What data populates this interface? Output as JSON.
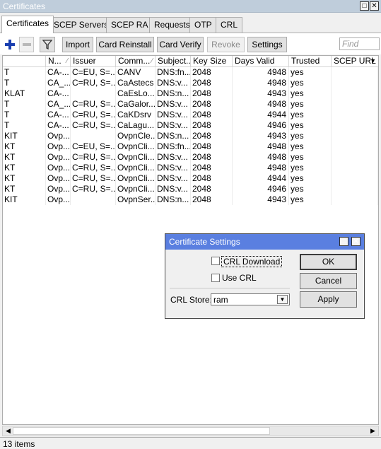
{
  "window": {
    "title": "Certificates"
  },
  "tabs": [
    "Certificates",
    "SCEP Servers",
    "SCEP RA",
    "Requests",
    "OTP",
    "CRL"
  ],
  "toolbar": {
    "add_icon": "plus-icon",
    "remove_icon": "minus-icon",
    "filter_icon": "filter-icon",
    "import": "Import",
    "card_reinstall": "Card Reinstall",
    "card_verify": "Card Verify",
    "revoke": "Revoke",
    "settings": "Settings",
    "find_placeholder": "Find"
  },
  "table": {
    "headers": [
      "",
      "N...",
      "Issuer",
      "Comm...",
      "Subject...",
      "Key Size",
      "Days Valid",
      "Trusted",
      "SCEP URL"
    ],
    "rows": [
      [
        "T",
        "CA-...",
        "C=EU, S=...",
        "CANV",
        "DNS:fn...",
        "2048",
        "4948",
        "yes",
        ""
      ],
      [
        "T",
        "CA_...",
        "C=RU, S=...",
        "CaAstecs",
        "DNS:v...",
        "2048",
        "4948",
        "yes",
        ""
      ],
      [
        "KLAT",
        "CA-...",
        "",
        "CaEsLo...",
        "DNS:n...",
        "2048",
        "4943",
        "yes",
        ""
      ],
      [
        "T",
        "CA_...",
        "C=RU, S=...",
        "CaGalor...",
        "DNS:v...",
        "2048",
        "4948",
        "yes",
        ""
      ],
      [
        "T",
        "CA-...",
        "C=RU, S=...",
        "CaKDsrv",
        "DNS:v...",
        "2048",
        "4944",
        "yes",
        ""
      ],
      [
        "T",
        "CA-...",
        "C=RU, S=...",
        "CaLagu...",
        "DNS:v...",
        "2048",
        "4946",
        "yes",
        ""
      ],
      [
        "KIT",
        "Ovp...",
        "",
        "OvpnCle...",
        "DNS:n...",
        "2048",
        "4943",
        "yes",
        ""
      ],
      [
        "KT",
        "Ovp...",
        "C=EU, S=...",
        "OvpnCli...",
        "DNS:fn...",
        "2048",
        "4948",
        "yes",
        ""
      ],
      [
        "KT",
        "Ovp...",
        "C=RU, S=...",
        "OvpnCli...",
        "DNS:v...",
        "2048",
        "4948",
        "yes",
        ""
      ],
      [
        "KT",
        "Ovp...",
        "C=RU, S=...",
        "OvpnCli...",
        "DNS:v...",
        "2048",
        "4948",
        "yes",
        ""
      ],
      [
        "KT",
        "Ovp...",
        "C=RU, S=...",
        "OvpnCli...",
        "DNS:v...",
        "2048",
        "4944",
        "yes",
        ""
      ],
      [
        "KT",
        "Ovp...",
        "C=RU, S=...",
        "OvpnCli...",
        "DNS:v...",
        "2048",
        "4946",
        "yes",
        ""
      ],
      [
        "KIT",
        "Ovp...",
        "",
        "OvpnSer...",
        "DNS:n...",
        "2048",
        "4943",
        "yes",
        ""
      ]
    ]
  },
  "status": {
    "count": "13 items"
  },
  "dialog": {
    "title": "Certificate Settings",
    "crl_download": "CRL Download",
    "use_crl": "Use CRL",
    "crl_store_label": "CRL Store:",
    "crl_store_value": "ram",
    "ok": "OK",
    "cancel": "Cancel",
    "apply": "Apply"
  }
}
